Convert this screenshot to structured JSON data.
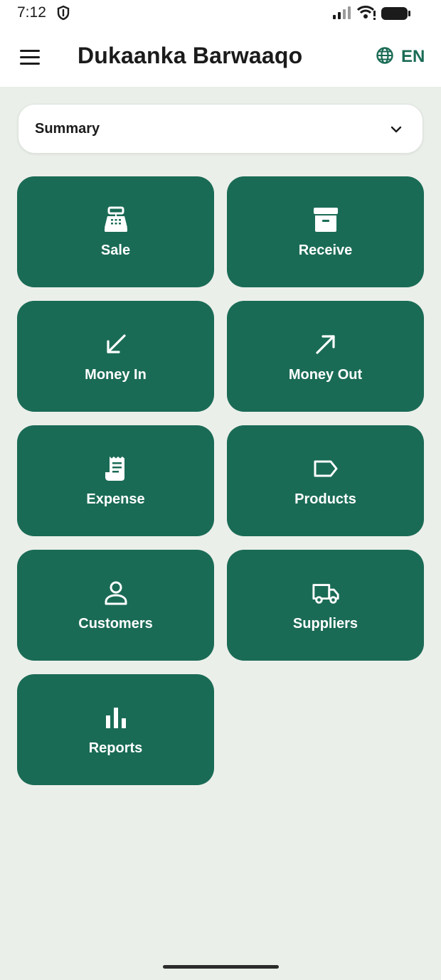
{
  "status_bar": {
    "time": "7:12",
    "icons": [
      "shield-icon",
      "signal-icon",
      "wifi-icon",
      "battery-icon"
    ]
  },
  "app_bar": {
    "title": "Dukaanka Barwaaqo",
    "language": "EN",
    "menu_icon": "hamburger-icon",
    "language_icon": "globe-icon"
  },
  "summary_dropdown": {
    "selected": "Summary",
    "icon": "chevron-down-icon"
  },
  "tiles": [
    {
      "label": "Sale",
      "icon": "cash-register-icon"
    },
    {
      "label": "Receive",
      "icon": "archive-box-icon"
    },
    {
      "label": "Money In",
      "icon": "arrow-down-left-icon"
    },
    {
      "label": "Money Out",
      "icon": "arrow-up-right-icon"
    },
    {
      "label": "Expense",
      "icon": "receipt-icon"
    },
    {
      "label": "Products",
      "icon": "tag-icon"
    },
    {
      "label": "Customers",
      "icon": "person-icon"
    },
    {
      "label": "Suppliers",
      "icon": "truck-icon"
    },
    {
      "label": "Reports",
      "icon": "bar-chart-icon"
    }
  ],
  "colors": {
    "accent": "#1a6b55",
    "background": "#ebefea",
    "surface": "#ffffff",
    "text": "#1b1b1b"
  }
}
